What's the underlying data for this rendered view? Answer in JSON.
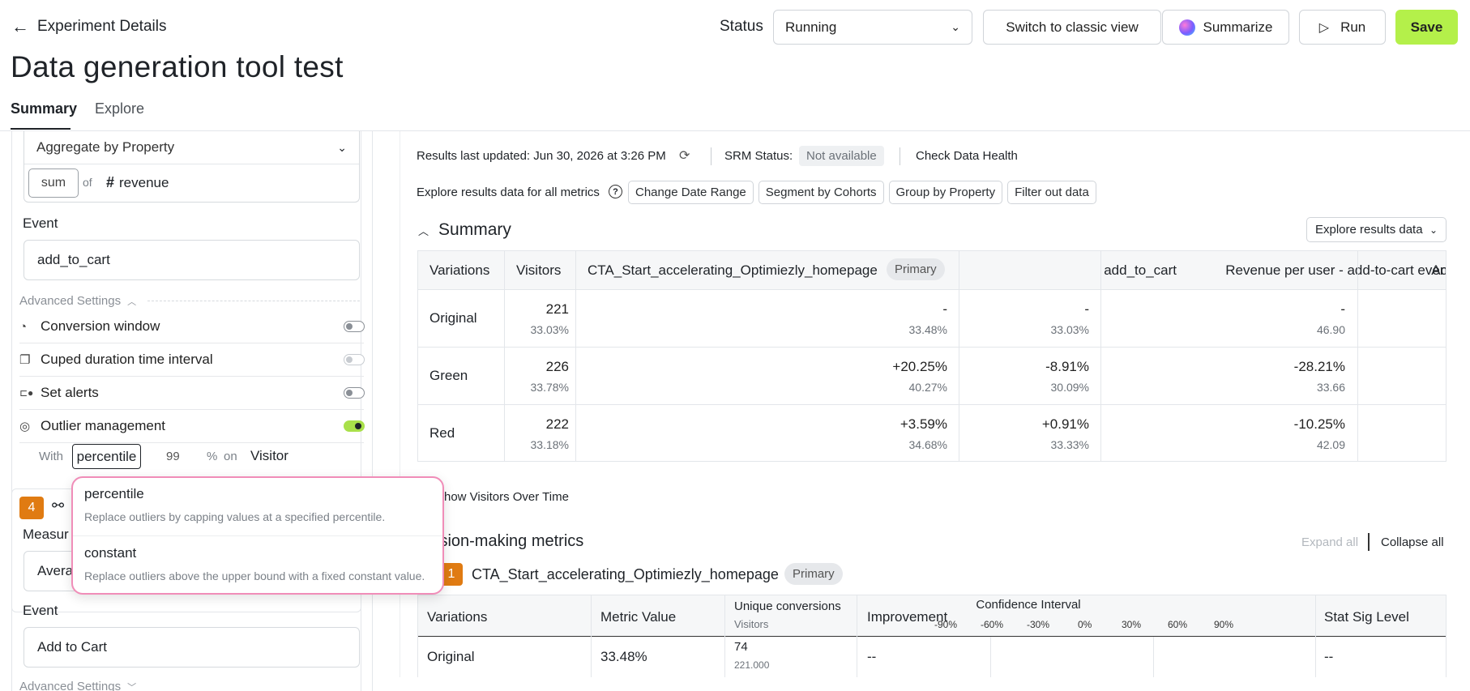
{
  "header": {
    "back_label": "Experiment Details",
    "title": "Data generation tool test",
    "status_label": "Status",
    "status_value": "Running",
    "classic_view": "Switch to classic view",
    "summarize": "Summarize",
    "run": "Run",
    "save": "Save",
    "tabs": [
      "Summary",
      "Explore"
    ]
  },
  "left": {
    "aggregate": "Aggregate by Property",
    "sum": "sum",
    "of": "of",
    "revenue": "revenue",
    "event_label": "Event",
    "event_value": "add_to_cart",
    "advanced": "Advanced Settings",
    "settings": [
      "Conversion window",
      "Cuped duration time interval",
      "Set alerts",
      "Outlier management"
    ],
    "with": "With",
    "percentile": "percentile",
    "pct_value": "99",
    "pct_sign": "%",
    "on": "on",
    "visitor": "Visitor",
    "metric_num": "4",
    "measure_partial": "Measur",
    "avg_partial": "Avera",
    "event_label2": "Event",
    "event_value2": "Add to Cart",
    "advanced2": "Advanced Settings"
  },
  "dropdown": {
    "options": [
      {
        "title": "percentile",
        "desc": "Replace outliers by capping values at a specified percentile."
      },
      {
        "title": "constant",
        "desc": "Replace outliers above the upper bound with a fixed constant value."
      }
    ]
  },
  "right": {
    "updated": "Results last updated: Jun 30, 2026 at 3:26 PM",
    "srm_label": "SRM Status:",
    "srm_value": "Not available",
    "health": "Check Data Health",
    "explore_text": "Explore results data for all metrics",
    "filters": [
      "Change Date Range",
      "Segment by Cohorts",
      "Group by Property",
      "Filter out data"
    ],
    "summary_title": "Summary",
    "explore_btn": "Explore results data",
    "summary_table": {
      "headers": [
        "Variations",
        "Visitors",
        "CTA_Start_accelerating_Optimiezly_homepage",
        "add_to_cart",
        "Revenue per user - add-to-cart event",
        "Add t"
      ],
      "primary": "Primary",
      "rows": [
        {
          "name": "Original",
          "visitors": "221",
          "visitors_pct": "33.03%",
          "c1": "-",
          "c1s": "33.48%",
          "c2": "-",
          "c2s": "33.03%",
          "c3": "-",
          "c3s": "46.90"
        },
        {
          "name": "Green",
          "visitors": "226",
          "visitors_pct": "33.78%",
          "c1": "+20.25%",
          "c1s": "40.27%",
          "c2": "-8.91%",
          "c2s": "30.09%",
          "c3": "-28.21%",
          "c3s": "33.66"
        },
        {
          "name": "Red",
          "visitors": "222",
          "visitors_pct": "33.18%",
          "c1": "+3.59%",
          "c1s": "34.68%",
          "c2": "+0.91%",
          "c2s": "33.33%",
          "c3": "-10.25%",
          "c3s": "42.09"
        }
      ]
    },
    "show_visitors": "how Visitors Over Time",
    "decision_title": "ision-making metrics",
    "expand_all": "Expand all",
    "collapse_all": "Collapse all",
    "metric_badge": "1",
    "metric_name": "CTA_Start_accelerating_Optimiezly_homepage",
    "metric_primary": "Primary",
    "metric_table": {
      "variations": "Variations",
      "metric_value": "Metric Value",
      "unique": "Unique conversions",
      "visitors": "Visitors",
      "improvement": "Improvement",
      "ci": "Confidence Interval",
      "ci_ticks": [
        "-90%",
        "-60%",
        "-30%",
        "0%",
        "30%",
        "60%",
        "90%"
      ],
      "stat_sig": "Stat Sig Level",
      "row": {
        "name": "Original",
        "value": "33.48%",
        "conv": "74",
        "visitors": "221.000",
        "improvement": "--",
        "stat": "--"
      }
    }
  }
}
